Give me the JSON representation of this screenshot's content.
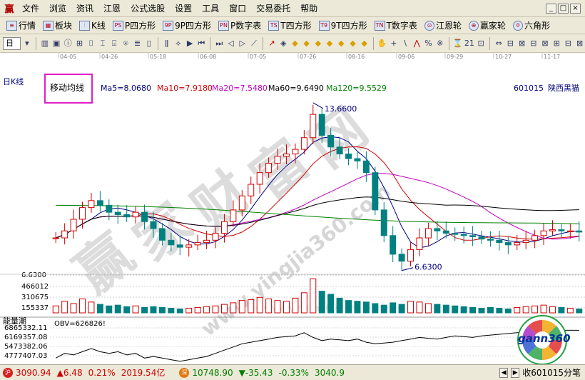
{
  "menubar": {
    "logo": "赢",
    "items": [
      "文件",
      "浏览",
      "资讯",
      "江恩",
      "公式选股",
      "设置",
      "工具",
      "窗口",
      "交易委托",
      "帮助"
    ],
    "window_buttons": [
      "_",
      "□",
      "×"
    ]
  },
  "toolbar1": {
    "items": [
      {
        "icon": "≡",
        "label": "行情"
      },
      {
        "icon": "▦",
        "label": "板块"
      },
      {
        "icon": "⫶",
        "label": "K线"
      },
      {
        "icon": "PS",
        "label": "P四方形"
      },
      {
        "icon": "9P",
        "label": "9P四方形"
      },
      {
        "icon": "PN",
        "label": "P数字表"
      },
      {
        "icon": "TS",
        "label": "T四方形"
      },
      {
        "icon": "T9",
        "label": "9T四方形"
      },
      {
        "icon": "TN",
        "label": "T数字表"
      },
      {
        "icon": "⊙",
        "label": "江恩轮"
      },
      {
        "icon": "⊕",
        "label": "赢家轮"
      },
      {
        "icon": "✡",
        "label": "六角形"
      }
    ]
  },
  "toolbar2": {
    "period": "日",
    "icons": [
      "▾",
      "▥",
      "▣",
      "ⓘ",
      "⊞",
      "⌷",
      "⌶",
      "⌺",
      "⍟",
      "≣",
      "▯",
      "ǁ",
      "⟡",
      "▶",
      "⏮",
      "⏭",
      "◁",
      "▷",
      "⟋",
      "↗",
      "◈",
      "◆",
      "◆",
      "◆",
      "◆",
      "◆",
      "◆",
      "◆",
      "✋",
      "+",
      "\\",
      "⋀",
      "%",
      "※",
      "⌛",
      "21",
      "⊡",
      "⇔",
      "⊟",
      "⊠",
      "⊟",
      "⊠",
      "⊞",
      "⊟",
      "⊠"
    ]
  },
  "chart": {
    "mode_label": "日K线",
    "indicator_label": "移动均线",
    "ma": [
      {
        "label": "Ma5=8.0680",
        "color": "#000080"
      },
      {
        "label": "Ma10=7.9180",
        "color": "#d00000"
      },
      {
        "label": "Ma20=7.5480",
        "color": "#c000c0"
      },
      {
        "label": "Ma60=9.6490",
        "color": "#000000"
      },
      {
        "label": "Ma120=9.5529",
        "color": "#008000"
      }
    ],
    "stock_code": "601015",
    "stock_name": "陕西黑猫",
    "date_labels": [
      "04-05",
      "04-26",
      "05-18",
      "06-08",
      "07-05",
      "07-26",
      "08-16",
      "09-06",
      "09-29",
      "10-27",
      "11-17"
    ],
    "high_label": "13.6600",
    "low_label": "6.6300",
    "left_price_label": "6.6300",
    "volume_ticks": [
      "466012",
      "310675",
      "155337"
    ],
    "obv_title": "能量潮",
    "obv_label": "OBV=626826!",
    "obv_ticks": [
      "6865332.11",
      "6169357.08",
      "5473382.06",
      "4777407.03"
    ],
    "watermark_chars": [
      "赢",
      "家",
      "财",
      "富",
      "网"
    ],
    "watermark_url": "www.yingjia360.com",
    "watermark_url_small": "www.yingjia360.com",
    "logo_text": "gann360"
  },
  "chart_data": {
    "type": "candlestick",
    "stock": "601015 陕西黑猫",
    "period": "daily",
    "date_ticks": [
      "04-05",
      "04-26",
      "05-18",
      "06-08",
      "07-05",
      "07-26",
      "08-16",
      "09-06",
      "09-29",
      "10-27",
      "11-17"
    ],
    "price_high": 13.66,
    "price_low": 6.63,
    "moving_averages": {
      "MA5": 8.068,
      "MA10": 7.918,
      "MA20": 7.548,
      "MA60": 9.649,
      "MA120": 9.5529
    },
    "volume_ticks": [
      466012,
      310675,
      155337
    ],
    "obv_last": 626826,
    "obv_ticks": [
      6865332.11,
      6169357.08,
      5473382.06,
      4777407.03
    ],
    "price_series": [
      7.8,
      8.1,
      8.6,
      9.1,
      9.4,
      9.2,
      8.9,
      8.8,
      8.7,
      8.9,
      8.5,
      8.2,
      7.7,
      7.5,
      7.4,
      7.5,
      7.6,
      7.7,
      8.0,
      8.5,
      9.0,
      9.6,
      10.1,
      10.6,
      11.0,
      11.3,
      11.4,
      11.6,
      12.1,
      13.1,
      12.2,
      11.7,
      11.4,
      11.2,
      11.1,
      10.6,
      9.0,
      7.9,
      7.1,
      6.8,
      7.3,
      7.8,
      8.2,
      8.1,
      8.0,
      7.95,
      7.9,
      7.85,
      7.75,
      7.7,
      7.6,
      7.5,
      7.6,
      7.7,
      7.9,
      8.1,
      8.15,
      8.1,
      8.1,
      8.05
    ],
    "volume_series": [
      90,
      150,
      120,
      180,
      140,
      110,
      90,
      100,
      80,
      90,
      70,
      80,
      70,
      60,
      50,
      60,
      70,
      80,
      90,
      110,
      130,
      160,
      170,
      200,
      180,
      160,
      150,
      190,
      260,
      440,
      280,
      240,
      190,
      160,
      150,
      140,
      120,
      100,
      130,
      110,
      150,
      140,
      120,
      110,
      100,
      90,
      80,
      70,
      60,
      70,
      60,
      50,
      70,
      80,
      90,
      100,
      80,
      70,
      60,
      50
    ],
    "obv_series": [
      5.0,
      5.3,
      5.2,
      5.4,
      5.6,
      5.4,
      5.3,
      5.4,
      5.2,
      5.3,
      5.0,
      5.1,
      5.0,
      4.9,
      4.8,
      4.9,
      5.0,
      5.1,
      5.3,
      5.5,
      5.7,
      5.9,
      6.0,
      6.1,
      6.2,
      6.3,
      6.35,
      6.4,
      6.6,
      6.3,
      6.1,
      6.2,
      6.15,
      6.1,
      6.2,
      6.0,
      5.9,
      5.95,
      6.0,
      6.1,
      6.2,
      6.3,
      6.25,
      6.2,
      6.3,
      6.4,
      6.35,
      6.3,
      6.4,
      6.45,
      6.5,
      6.55,
      6.6,
      6.65,
      6.7,
      6.8,
      6.85,
      6.75,
      6.75,
      6.75
    ]
  },
  "statusbar": {
    "sh_icon": "沪",
    "sh_index": "3090.94",
    "sh_change": "6.48",
    "sh_pct": "0.21%",
    "sh_amount": "2019.54亿",
    "sz_icon": "深",
    "sz_index": "10748.90",
    "sz_change": "-35.43",
    "sz_pct": "-0.33%",
    "sz_amount": "3040.9",
    "right_text": "收601015分笔"
  }
}
